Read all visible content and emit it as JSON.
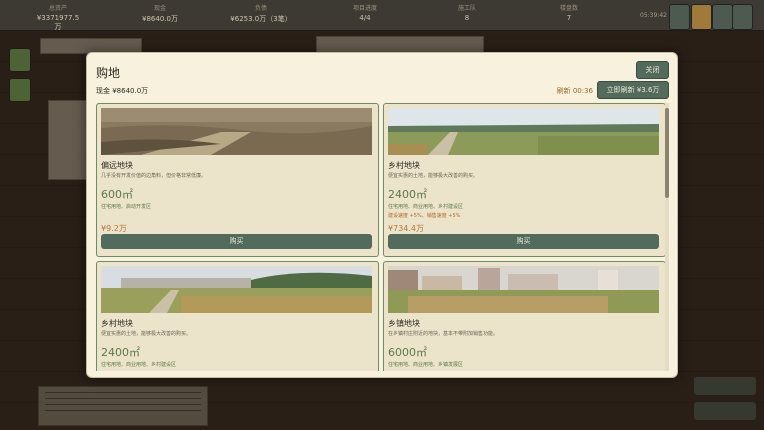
{
  "topbar": {
    "stats": [
      {
        "icon": "assets-icon",
        "label": "总资产",
        "value": "¥3371977.5万"
      },
      {
        "icon": "cash-icon",
        "label": "现金",
        "value": "¥8640.0万"
      },
      {
        "icon": "debt-icon",
        "label": "负债",
        "value": "¥6253.0万（3笔）"
      },
      {
        "icon": "project-icon",
        "label": "项目进度",
        "value": "4/4"
      },
      {
        "icon": "worker-icon",
        "label": "施工队",
        "value": "8"
      },
      {
        "icon": "building-icon",
        "label": "楼盘数",
        "value": "7"
      }
    ],
    "date": "05:39:42",
    "buttons": [
      "",
      "",
      "",
      ""
    ]
  },
  "modal": {
    "title": "购地",
    "close_label": "关闭",
    "cash_text": "现金 ¥8640.0万",
    "refresh_timer": "刷新 00:36",
    "refresh_label": "立即刷新 ¥3.6万"
  },
  "plots": [
    {
      "name": "偏远地块",
      "desc": "几乎没有开发价值的边角料，但价格非常低廉。",
      "area": "600㎡",
      "usage": "住宅用地、启动开发区",
      "bonus": "",
      "price": "¥9.2万",
      "buy_label": "购买"
    },
    {
      "name": "乡村地块",
      "desc": "便宜实惠的土地，能够极大改善的购买。",
      "area": "2400㎡",
      "usage": "住宅用地、商业用地、乡村建设区",
      "bonus": "建设速度 +5%、销售速度 +5%",
      "price": "¥734.4万",
      "buy_label": "购买"
    },
    {
      "name": "乡村地块",
      "desc": "便宜实惠的土地，能够极大改善的购买。",
      "area": "2400㎡",
      "usage": "住宅用地、商业用地、乡村建设区",
      "bonus": "",
      "price": "",
      "buy_label": ""
    },
    {
      "name": "乡镇地块",
      "desc": "在乡镇村庄附近的地块，基本不带附加销售功能。",
      "area": "6000㎡",
      "usage": "住宅用地、商业用地、乡镇发展区",
      "bonus": "",
      "price": "",
      "buy_label": ""
    }
  ],
  "colors": {
    "accent": "#536b5c",
    "modal_bg": "#f8f1dd",
    "card_border": "#6f8b64",
    "price": "#b07a3a"
  }
}
